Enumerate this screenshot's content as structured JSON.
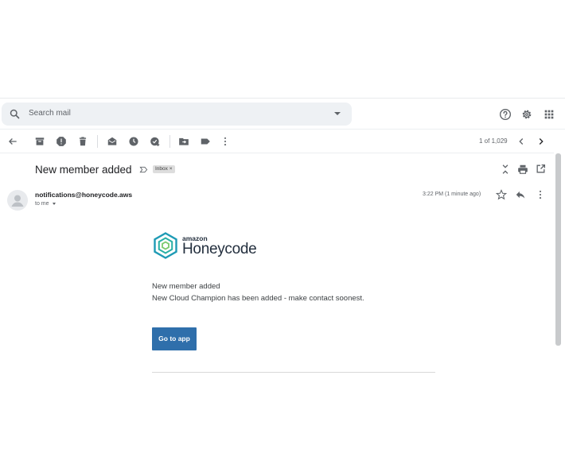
{
  "search": {
    "placeholder": "Search mail"
  },
  "toolbar": {
    "pager": "1 of 1,029"
  },
  "message": {
    "subject": "New member added",
    "label": "Inbox ×",
    "sender": "notifications@honeycode.aws",
    "recipient": "to me",
    "time": "3:22 PM (1 minute ago)"
  },
  "email_body": {
    "brand_small": "amazon",
    "brand_large": "Honeycode",
    "line1": "New member added",
    "line2": "New Cloud Champion has been added - make contact soonest.",
    "button_label": "Go to app"
  },
  "icons": [
    "search-icon",
    "dropdown-caret-icon",
    "help-icon",
    "settings-gear-icon",
    "apps-grid-icon",
    "back-arrow-icon",
    "archive-icon",
    "report-spam-icon",
    "delete-icon",
    "mark-unread-icon",
    "snooze-icon",
    "add-to-tasks-icon",
    "move-to-icon",
    "label-icon",
    "more-vert-icon",
    "chevron-left-icon",
    "chevron-right-icon",
    "important-marker-icon",
    "collapse-all-icon",
    "print-icon",
    "open-new-window-icon",
    "avatar-icon",
    "star-icon",
    "reply-icon",
    "honeycode-logo-icon"
  ],
  "colors": {
    "accent_button": "#2f6fab",
    "logo_teal": "#1f9bb5"
  }
}
